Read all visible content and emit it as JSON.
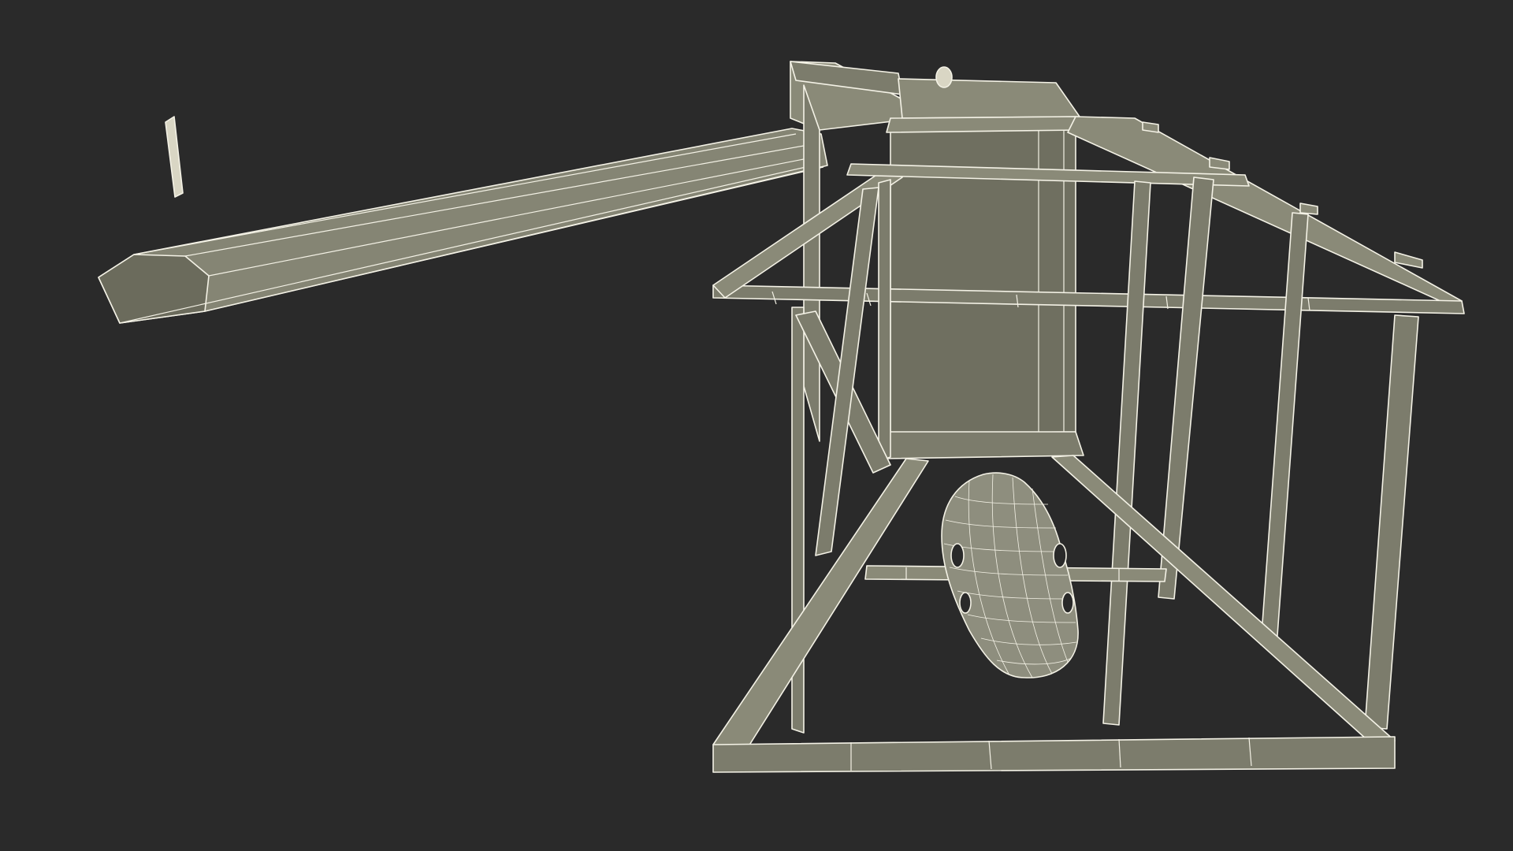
{
  "scene": {
    "subject": "wireframe-mine-headframe-with-vehicle",
    "colors": {
      "background": "#2a2a2a",
      "beam_fill": "#7c7c6c",
      "beam_fill_dark": "#6b6b5c",
      "beam_fill_light": "#8a8a78",
      "wire": "#f4f2e6",
      "chute_fill": "#858574"
    }
  }
}
